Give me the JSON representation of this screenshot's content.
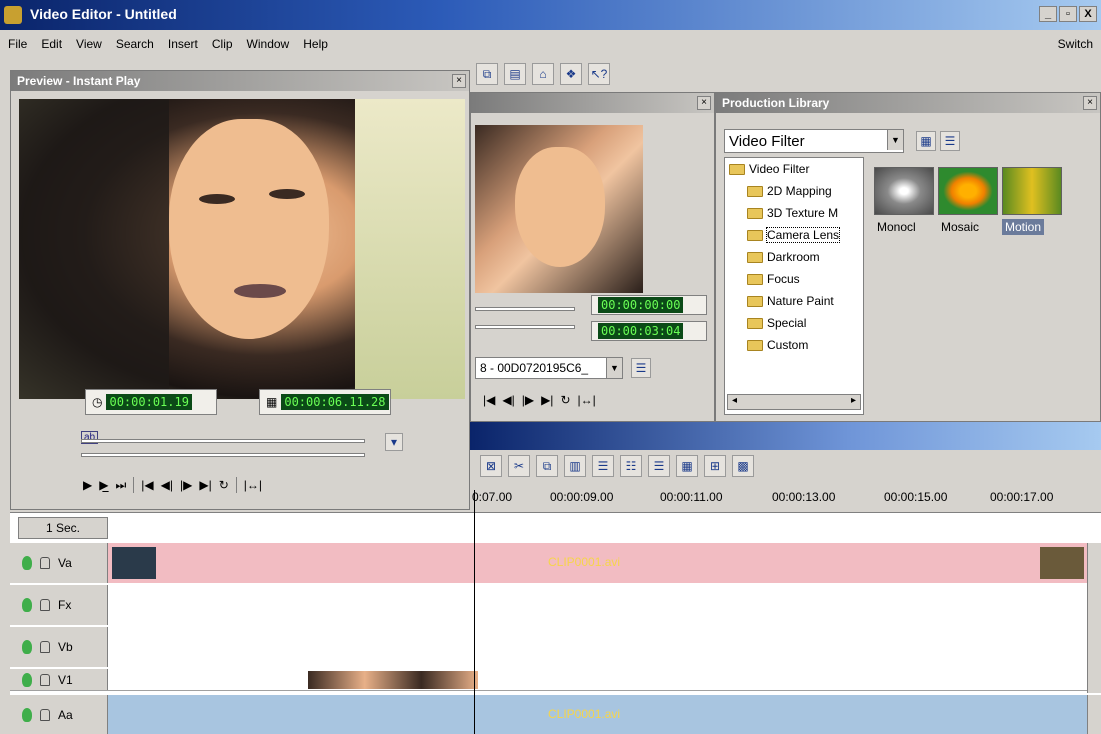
{
  "window": {
    "title": "Video Editor - Untitled",
    "controls": [
      "_",
      "▫",
      "X"
    ]
  },
  "menu": {
    "items": [
      "File",
      "Edit",
      "View",
      "Search",
      "Insert",
      "Clip",
      "Window",
      "Help"
    ],
    "switch_label": "Switch"
  },
  "toolbar": {
    "icons": [
      "open-clip-icon",
      "library-icon",
      "home-icon",
      "effects-icon",
      "help-pointer-icon"
    ],
    "glyphs": [
      "⧉",
      "▤",
      "⌂",
      "❖",
      "↖?"
    ]
  },
  "preview": {
    "title": "Preview - Instant Play",
    "timecode_current": "00:00:01.19",
    "timecode_duration": "00:00:06.11.28",
    "transport": [
      "▶",
      "▶̲",
      "⏭",
      "|◀",
      "◀|",
      "|▶",
      "▶|",
      "↻",
      "|↔|"
    ],
    "slider_label": "ab"
  },
  "mid": {
    "timecode_a": "00:00:00:00",
    "timecode_b": "00:00:03:04",
    "device": "8 - 00D0720195C6_",
    "transport": [
      "|◀",
      "◀|",
      "|▶",
      "▶|",
      "↻",
      "|↔|"
    ]
  },
  "library": {
    "title": "Production Library",
    "category": "Video Filter",
    "tree": [
      "Video Filter",
      "2D Mapping",
      "3D Texture M",
      "Camera Lens",
      "Darkroom",
      "Focus",
      "Nature Paint",
      "Special",
      "Custom"
    ],
    "thumbs": [
      "Monocl",
      "Mosaic",
      "Motion"
    ],
    "colors": {
      "selected_label_bg": "#6b7b9b"
    }
  },
  "timeline": {
    "scale": "1 Sec.",
    "ruler": [
      "0:07.00",
      "00:00:09.00",
      "00:00:11.00",
      "00:00:13.00",
      "00:00:15.00",
      "00:00:17.00"
    ],
    "tracks": [
      {
        "name": "Va",
        "clip": "CLIP0001.avi",
        "color": "#f2bcc2"
      },
      {
        "name": "Fx",
        "clip": "",
        "color": "#ffffff"
      },
      {
        "name": "Vb",
        "clip": "",
        "color": "#ffffff"
      },
      {
        "name": "V1",
        "clip": "",
        "color": "#ffffff"
      },
      {
        "name": "Aa",
        "clip": "CLIP0001.avi",
        "color": "#a8c5e0"
      }
    ]
  }
}
